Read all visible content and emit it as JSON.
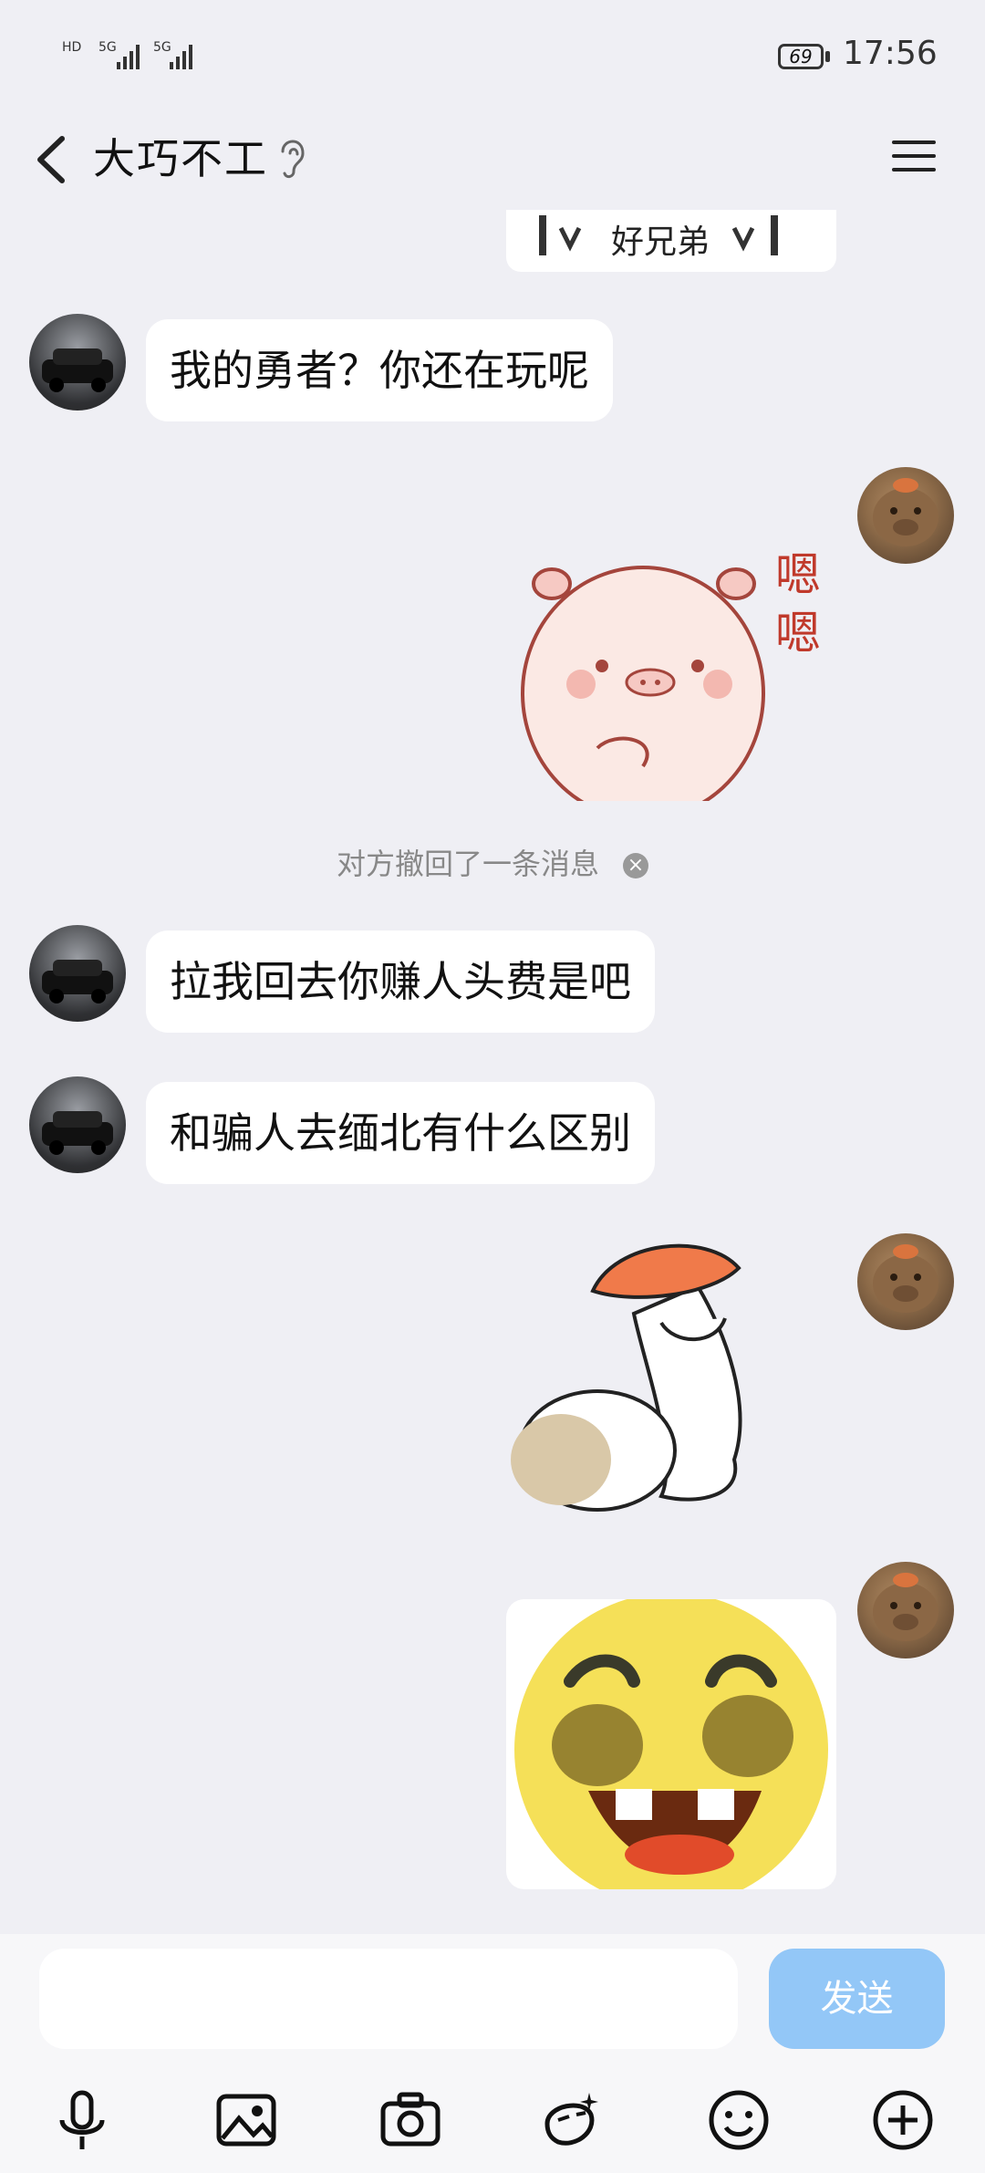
{
  "status_bar": {
    "signal_labels": [
      "HD",
      "5G",
      "5G"
    ],
    "battery": "69",
    "time": "17:56"
  },
  "header": {
    "title": "大巧不工"
  },
  "messages": {
    "sticker_caption": "好兄弟",
    "msg1": "我的勇者？你还在玩呢",
    "sticker_pig_text": "嗯嗯",
    "recall_notice": "对方撤回了一条消息",
    "msg2": "拉我回去你赚人头费是吧",
    "msg3": "和骗人去缅北有什么区别"
  },
  "input_bar": {
    "input_value": "",
    "send_label": "发送"
  },
  "icons": [
    "back-icon",
    "ear-icon",
    "menu-icon",
    "microphone-icon",
    "image-icon",
    "camera-icon",
    "magic-face-icon",
    "emoji-icon",
    "plus-icon"
  ]
}
